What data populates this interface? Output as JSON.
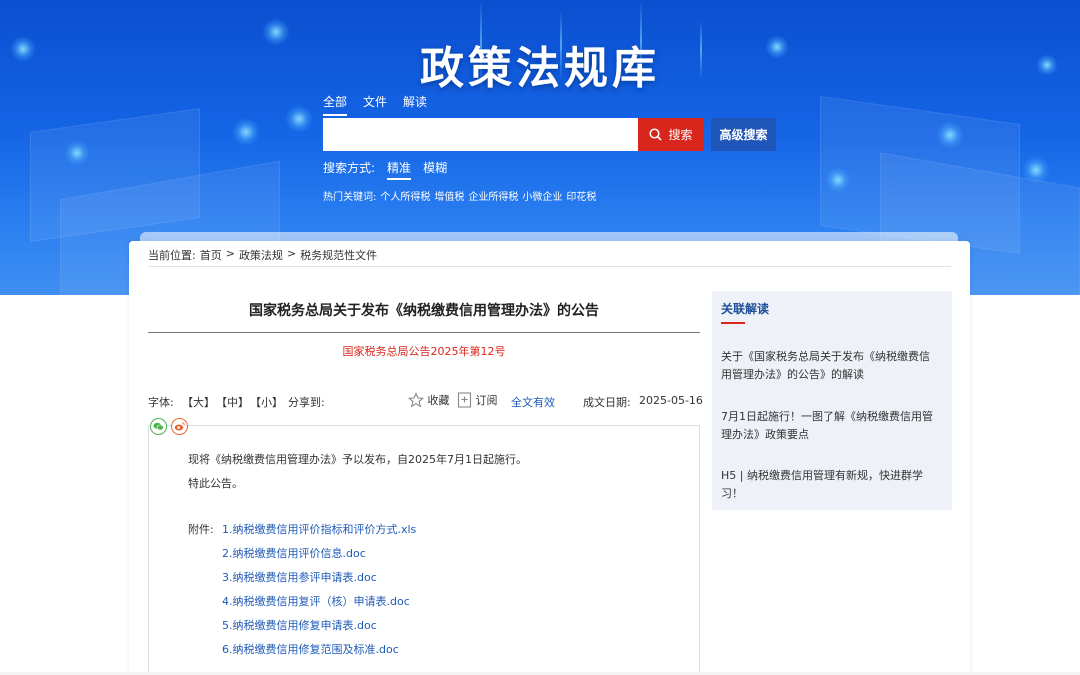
{
  "header": {
    "site_title": "政策法规库",
    "tabs": [
      "全部",
      "文件",
      "解读"
    ],
    "search_placeholder": "",
    "search_button": "搜索",
    "advanced_search_button": "高级搜索",
    "search_mode_label": "搜索方式:",
    "search_modes": [
      "精准",
      "模糊"
    ],
    "hot_keywords_label": "热门关键词:",
    "hot_keywords": [
      "个人所得税",
      "增值税",
      "企业所得税",
      "小微企业",
      "印花税"
    ]
  },
  "breadcrumb": {
    "label": "当前位置:",
    "items": [
      "首页",
      "政策法规",
      "税务规范性文件"
    ],
    "separator": ">"
  },
  "document": {
    "title": "国家税务总局关于发布《纳税缴费信用管理办法》的公告",
    "number": "国家税务总局公告2025年第12号",
    "font_label": "字体:",
    "font_sizes": [
      "【大】",
      "【中】",
      "【小】"
    ],
    "share_label": "分享到:",
    "favorite": "收藏",
    "subscribe": "订阅",
    "validity": "全文有效",
    "date_label": "成文日期:",
    "date": "2025-05-16",
    "paragraphs": [
      "现将《纳税缴费信用管理办法》予以发布，自2025年7月1日起施行。",
      "特此公告。"
    ],
    "attachments_label": "附件:",
    "attachments": [
      "1.纳税缴费信用评价指标和评价方式.xls",
      "2.纳税缴费信用评价信息.doc",
      "3.纳税缴费信用参评申请表.doc",
      "4.纳税缴费信用复评（核）申请表.doc",
      "5.纳税缴费信用修复申请表.doc",
      "6.纳税缴费信用修复范围及标准.doc"
    ]
  },
  "sidebar": {
    "title": "关联解读",
    "items": [
      "关于《国家税务总局关于发布《纳税缴费信用管理办法》的公告》的解读",
      "7月1日起施行！一图了解《纳税缴费信用管理办法》政策要点",
      "H5 | 纳税缴费信用管理有新规，快进群学习！"
    ]
  },
  "colors": {
    "banner_blue": "#1565e6",
    "search_red": "#d9261c",
    "advanced_blue": "#1f55b8",
    "link_blue": "#1f5ab8",
    "doc_number_red": "#d9261c"
  },
  "icons": {
    "search": "search-icon",
    "favorite": "star-icon",
    "subscribe": "bookmark-plus-icon",
    "wechat": "wechat-icon",
    "weibo": "weibo-icon"
  }
}
